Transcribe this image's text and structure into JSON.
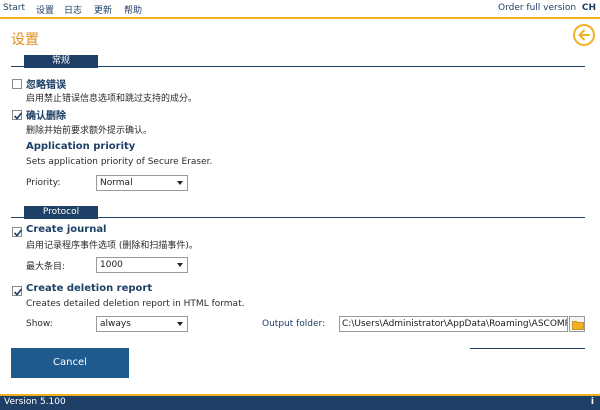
{
  "menu": {
    "items": [
      "Start",
      "设置",
      "日志",
      "更新",
      "帮助"
    ],
    "order_label": "Order full version",
    "lang": "CH"
  },
  "page": {
    "title": "设置"
  },
  "sections": {
    "general": {
      "label": "常规"
    },
    "protocol": {
      "label": "Protocol"
    }
  },
  "options": {
    "ignore_errors": {
      "title": "忽略错误",
      "desc": "启用禁止错误信息选项和跳过支持的成分。",
      "checked": false
    },
    "confirm_delete": {
      "title": "确认删除",
      "desc": "删除并始前要求额外提示确认。",
      "checked": true
    },
    "priority": {
      "title": "Application priority",
      "desc": "Sets application priority of Secure Eraser.",
      "label": "Priority:",
      "value": "Normal"
    },
    "journal": {
      "title": "Create journal",
      "desc": "启用记录程序事件选项 (删除和扫描事件)。",
      "checked": true,
      "max_label": "最大条目:",
      "max_value": "1000"
    },
    "report": {
      "title": "Create deletion report",
      "desc": "Creates detailed deletion report in HTML format.",
      "checked": true,
      "show_label": "Show:",
      "show_value": "always",
      "folder_label": "Output folder:",
      "folder_value": "C:\\Users\\Administrator\\AppData\\Roaming\\ASCOMP"
    }
  },
  "buttons": {
    "cancel": "Cancel"
  },
  "status": {
    "version": "Version 5.100",
    "info_icon": "i"
  },
  "colors": {
    "accent": "#f0b020",
    "navy": "#1e3f66",
    "title": "#e08f1a",
    "button": "#1e5a8e"
  }
}
